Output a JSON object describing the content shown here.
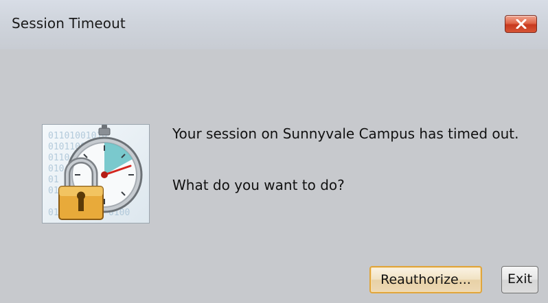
{
  "window": {
    "title": "Session Timeout",
    "close_icon": "close-icon",
    "close_color": "#d65535"
  },
  "icon": {
    "name": "session-timeout-icon",
    "binary_pattern": [
      "01101001010",
      "01011001000",
      "0110",
      "010",
      "01",
      "0110100"
    ]
  },
  "message": {
    "line1": "Your session on Sunnyvale Campus has timed out.",
    "line2": "What do you want to do?"
  },
  "buttons": {
    "reauthorize_label": "Reauthorize...",
    "exit_label": "Exit",
    "default_accent": "#e0a53c"
  }
}
